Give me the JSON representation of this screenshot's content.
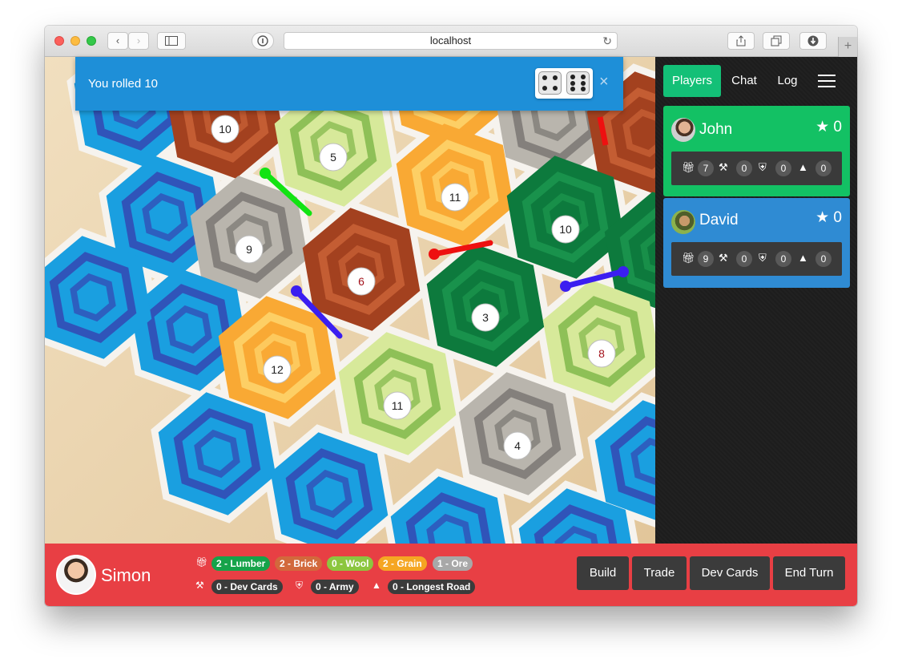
{
  "browser": {
    "url": "localhost",
    "back_glyph": "‹",
    "forward_glyph": "›",
    "reload_glyph": "↻",
    "newtab_glyph": "+"
  },
  "notification": {
    "message": "You rolled 10",
    "dice": [
      4,
      6
    ],
    "close_glyph": "×"
  },
  "board": {
    "numbers": [
      "10",
      "5",
      "11",
      "10",
      "9",
      "6",
      "3",
      "8",
      "12",
      "11",
      "4"
    ],
    "colors": {
      "water": "#1a9fe0",
      "brick": "#a3411f",
      "wheat": "#f9a934",
      "pasture": "#d7e99a",
      "forest": "#0d7a3d",
      "ore": "#b9b5ad",
      "rare_number": "#a3121b",
      "player_green": "#12e312",
      "player_red": "#ee1010",
      "player_blue": "#3b1ef0"
    }
  },
  "sidebar": {
    "tabs": [
      "Players",
      "Chat",
      "Log"
    ],
    "active_tab": "Players",
    "menu_icon": "hamburger-menu-icon",
    "players": [
      {
        "name": "John",
        "victory_points": "0",
        "color": "#13c164",
        "dev_cards": "7",
        "army": "0",
        "roads": "0",
        "longest_road": "0"
      },
      {
        "name": "David",
        "victory_points": "0",
        "color": "#2f8bd3",
        "dev_cards": "9",
        "army": "0",
        "roads": "0",
        "longest_road": "0"
      }
    ]
  },
  "self": {
    "name": "Simon",
    "color": "#e83f44",
    "resources": [
      {
        "label": "2 - Lumber",
        "color": "#16a34a"
      },
      {
        "label": "2 - Brick",
        "color": "#d2693c"
      },
      {
        "label": "0 - Wool",
        "color": "#8cc63f"
      },
      {
        "label": "2 - Grain",
        "color": "#f5a623"
      },
      {
        "label": "1 - Ore",
        "color": "#a8a8a8"
      }
    ],
    "dev_cards": "0 - Dev Cards",
    "army": "0 - Army",
    "longest_road": "0 - Longest Road"
  },
  "actions": [
    "Build",
    "Trade",
    "Dev Cards",
    "End Turn"
  ]
}
